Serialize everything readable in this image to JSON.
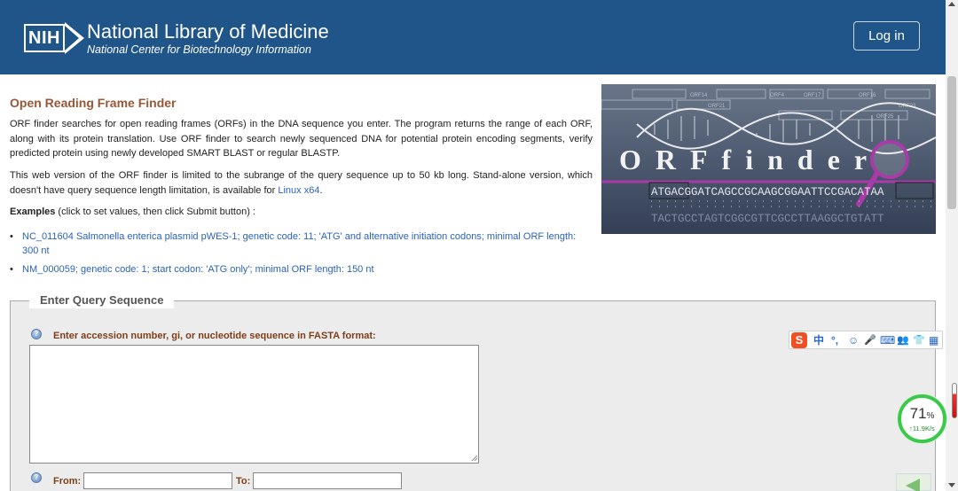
{
  "header": {
    "logo_text": "NIH",
    "org_title": "National Library of Medicine",
    "org_subtitle": "National Center for Biotechnology Information",
    "login_label": "Log in",
    "bg_color": "#20558a"
  },
  "main": {
    "title": "Open Reading Frame Finder",
    "intro_1": "ORF finder searches for open reading frames (ORFs) in the DNA sequence you enter. The program returns the range of each ORF, along with its protein translation. Use ORF finder to search newly sequenced DNA for potential protein encoding segments, verify predicted protein using newly developed SMART BLAST or regular BLASTP.",
    "intro_2_text": "This web version of the ORF finder is limited to the subrange of the query sequence up to 50 kb long. Stand-alone version, which doesn't have query sequence length limitation, is available for ",
    "intro_2_link": "Linux x64",
    "intro_2_end": ".",
    "examples_bold": "Examples",
    "examples_rest": " (click to set values, then click Submit button) :",
    "example_links": [
      "NC_011604 Salmonella enterica plasmid pWES-1; genetic code: 11; 'ATG' and alternative initiation codons; minimal ORF length: 300 nt",
      "NM_000059; genetic code: 1; start codon: 'ATG only'; minimal ORF length: 150 nt"
    ],
    "bullet": "•"
  },
  "banner": {
    "word": "ORFfinder",
    "seq_top": "ATGACGGATCAGCCGCAAGCGGAATTCCGACATAA",
    "seq_bottom": "TACTGCCTAGTCGGCGTTCGCCTTAAGGCTGTATT",
    "orf_labels": [
      "ORF14",
      "ORF21",
      "ORF4",
      "ORF17",
      "ORF16",
      "ORF23",
      "ORF25"
    ]
  },
  "query": {
    "legend": "Enter Query Sequence",
    "help_glyph": "?",
    "seq_label": "Enter accession number, gi, or nucleotide sequence in FASTA format:",
    "seq_value": "",
    "from_label": "From:",
    "from_value": "",
    "to_label": "To:",
    "to_value": ""
  },
  "ime_toolbar": {
    "logo": "S",
    "items": [
      "中",
      "°,",
      "☺",
      "🎤",
      "⌨",
      "👥",
      "👕",
      "▦"
    ]
  },
  "network_widget": {
    "percent": "71",
    "percent_unit": "%",
    "speed": "↑11.9K/s",
    "ring_color": "#3cc84a"
  }
}
